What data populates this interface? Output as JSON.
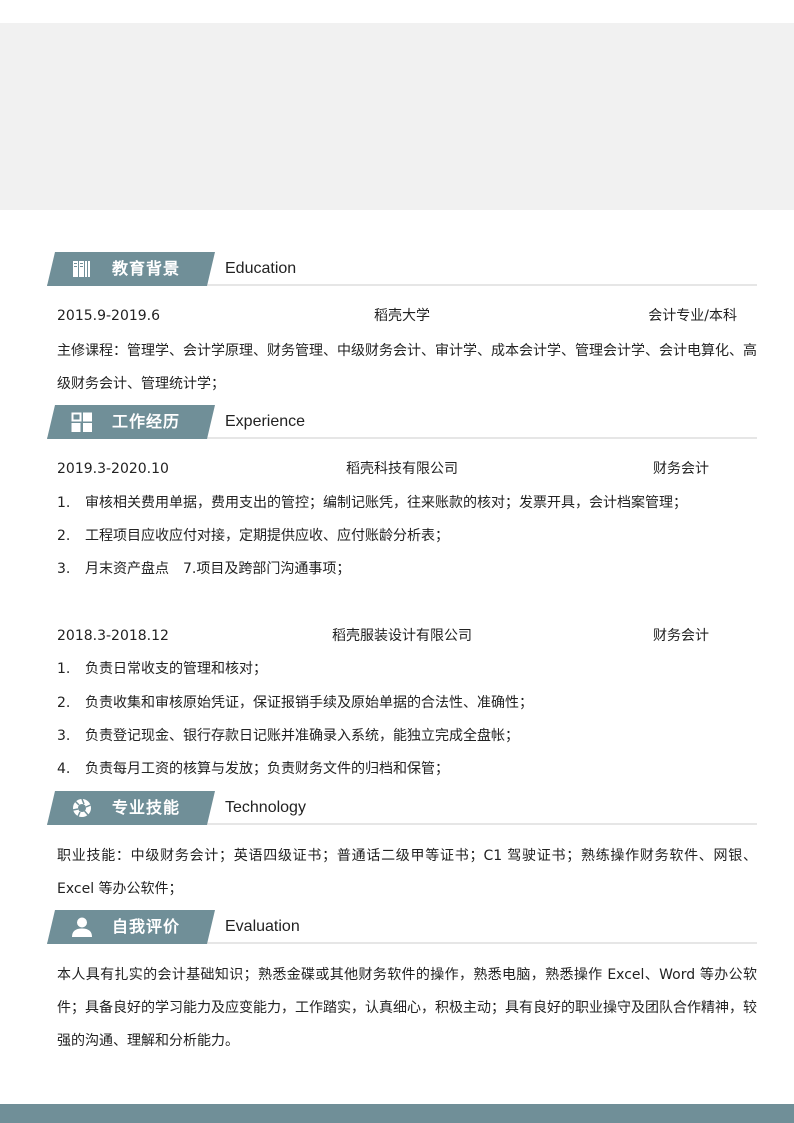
{
  "theme": {
    "accent": "#708f98",
    "header_band": "#f1f1f1",
    "divider": "#e6e6e6"
  },
  "sections": {
    "education": {
      "icon": "books-icon",
      "title_cn": "教育背景",
      "title_en": "Education",
      "entry": {
        "period": "2015.9-2019.6",
        "school": "稻壳大学",
        "major": "会计专业/本科"
      },
      "courses": "主修课程：管理学、会计学原理、财务管理、中级财务会计、审计学、成本会计学、管理会计学、会计电算化、高级财务会计、管理统计学；"
    },
    "experience": {
      "icon": "grid-icon",
      "title_cn": "工作经历",
      "title_en": "Experience",
      "jobs": [
        {
          "period": "2019.3-2020.10",
          "company": "稻壳科技有限公司",
          "position": "财务会计",
          "duties": [
            {
              "num": "1.",
              "text": "审核相关费用单据，费用支出的管控；编制记账凭，往来账款的核对；发票开具，会计档案管理；"
            },
            {
              "num": "2.",
              "text": "工程项目应收应付对接，定期提供应收、应付账龄分析表；"
            },
            {
              "num": "3.",
              "text": "月末资产盘点　7.项目及跨部门沟通事项；"
            }
          ]
        },
        {
          "period": "2018.3-2018.12",
          "company": "稻壳服装设计有限公司",
          "position": "财务会计",
          "duties": [
            {
              "num": "1.",
              "text": "负责日常收支的管理和核对；"
            },
            {
              "num": "2.",
              "text": "负责收集和审核原始凭证，保证报销手续及原始单据的合法性、准确性；"
            },
            {
              "num": "3.",
              "text": "负责登记现金、银行存款日记账并准确录入系统，能独立完成全盘帐；"
            },
            {
              "num": "4.",
              "text": "负责每月工资的核算与发放；负责财务文件的归档和保管；"
            }
          ]
        }
      ]
    },
    "skills": {
      "icon": "aperture-icon",
      "title_cn": "专业技能",
      "title_en": "Technology",
      "text": "职业技能：中级财务会计；英语四级证书；普通话二级甲等证书；C1 驾驶证书；熟练操作财务软件、网银、Excel 等办公软件；"
    },
    "evaluation": {
      "icon": "user-icon",
      "title_cn": "自我评价",
      "title_en": "Evaluation",
      "text": "本人具有扎实的会计基础知识；熟悉金碟或其他财务软件的操作，熟悉电脑，熟悉操作 Excel、Word 等办公软件；具备良好的学习能力及应变能力，工作踏实，认真细心，积极主动；具有良好的职业操守及团队合作精神，较强的沟通、理解和分析能力。"
    }
  }
}
